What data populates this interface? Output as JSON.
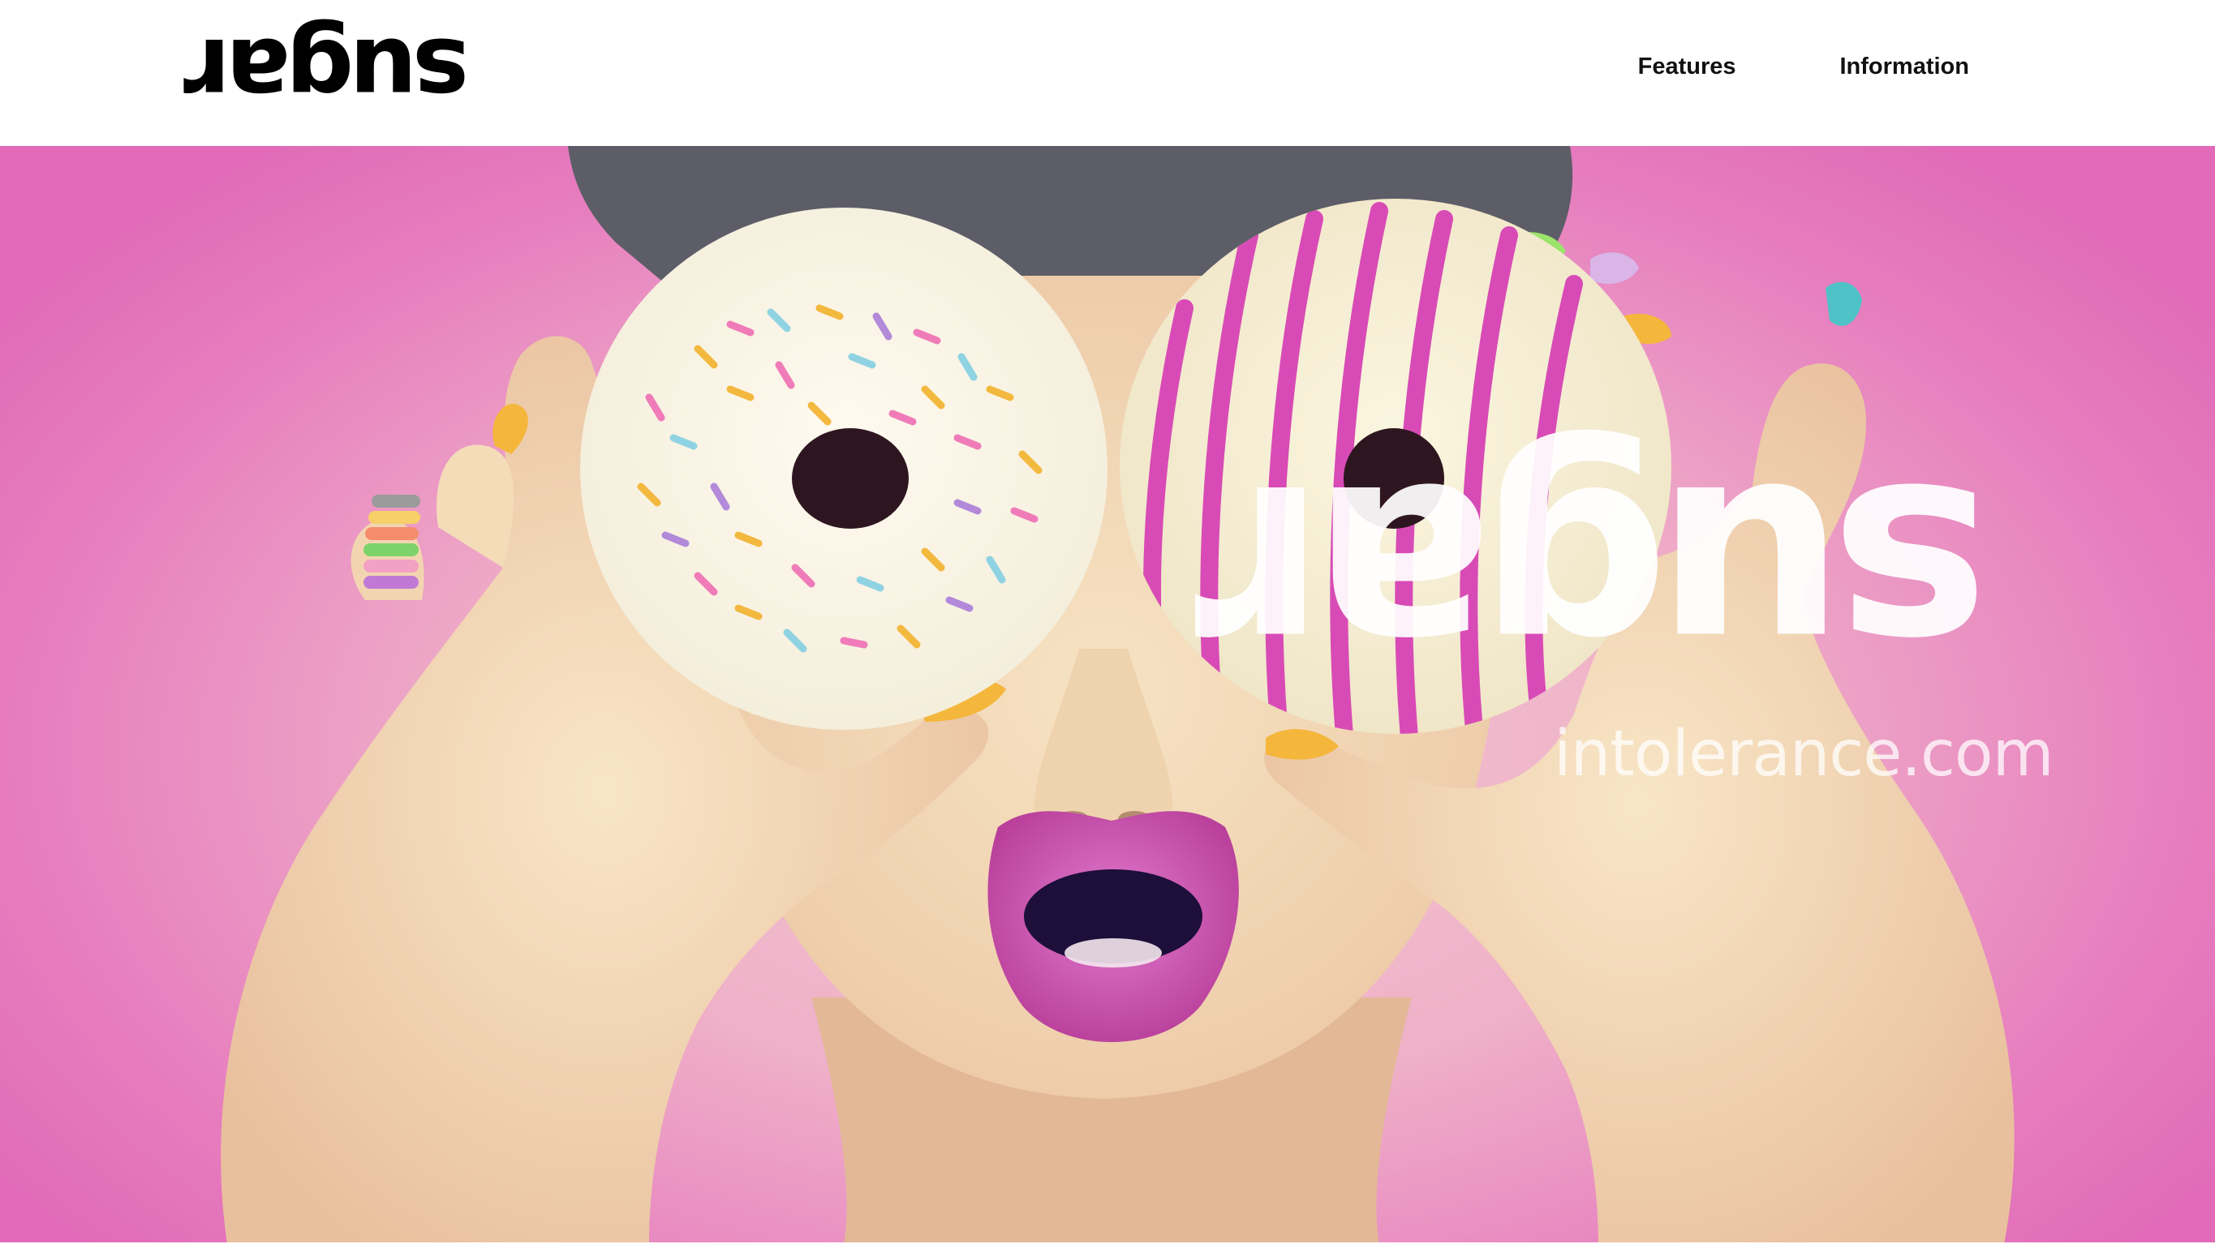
{
  "header": {
    "logo_text": "sugar",
    "nav": {
      "features": "Features",
      "information": "Information"
    }
  },
  "hero": {
    "brand_logo_text": "sugar",
    "brand_domain": "intolerance.com"
  },
  "colors": {
    "background": "#ffffff",
    "nav_text": "#111111",
    "hero_pink": "#e77fbf",
    "lipstick": "#c9409f"
  },
  "icons": []
}
